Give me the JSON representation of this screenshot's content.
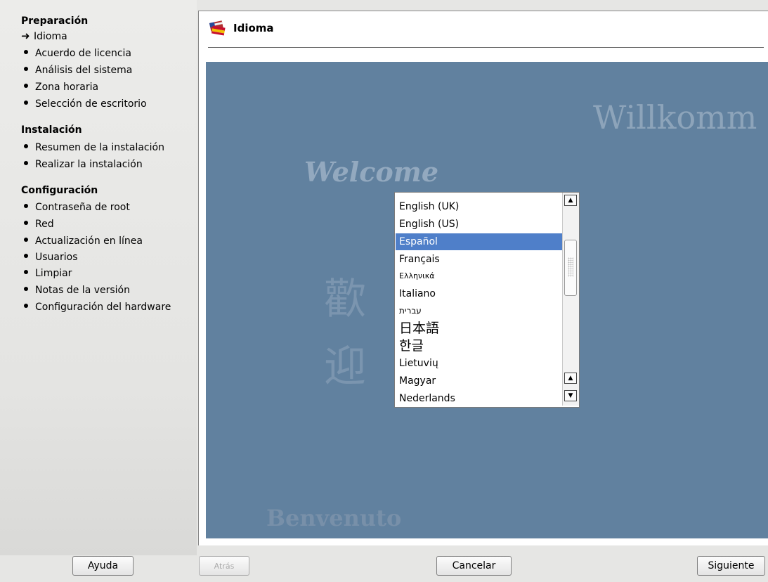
{
  "sidebar": {
    "sections": [
      {
        "title": "Preparación",
        "items": [
          {
            "label": "Idioma",
            "current": true
          },
          {
            "label": "Acuerdo de licencia"
          },
          {
            "label": "Análisis del sistema"
          },
          {
            "label": "Zona horaria"
          },
          {
            "label": "Selección de escritorio"
          }
        ]
      },
      {
        "title": "Instalación",
        "items": [
          {
            "label": "Resumen de la instalación"
          },
          {
            "label": "Realizar la instalación"
          }
        ]
      },
      {
        "title": "Configuración",
        "items": [
          {
            "label": "Contraseña de root"
          },
          {
            "label": "Red"
          },
          {
            "label": "Actualización en línea"
          },
          {
            "label": "Usuarios"
          },
          {
            "label": "Limpiar"
          },
          {
            "label": "Notas de la versión"
          },
          {
            "label": "Configuración del hardware"
          }
        ]
      }
    ]
  },
  "main": {
    "title": "Idioma",
    "background_words": {
      "willkommen": "Willkomm",
      "welcome": "Welcome",
      "benvenuto": "Benvenuto",
      "kanji": "歡\n迎"
    },
    "language_list": {
      "selected": "Español",
      "items": [
        "English (UK)",
        "English (US)",
        "Español",
        "Français",
        "Ελληνικά",
        "Italiano",
        "עברית",
        "日本語",
        "한글",
        "Lietuvių",
        "Magyar",
        "Nederlands"
      ]
    }
  },
  "buttons": {
    "help": "Ayuda",
    "back": "Atrás",
    "cancel": "Cancelar",
    "next": "Siguiente"
  },
  "colors": {
    "background_area": "#61819f",
    "selection": "#4f7fc9"
  }
}
